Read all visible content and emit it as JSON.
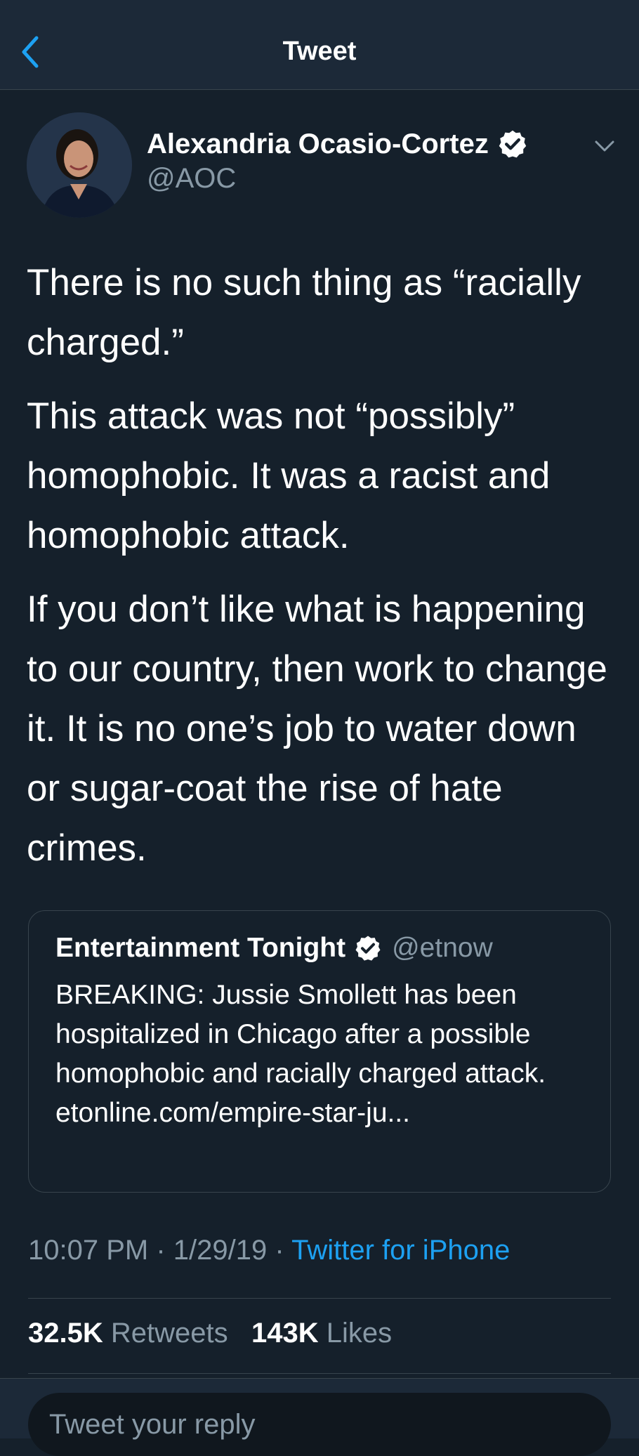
{
  "nav": {
    "title": "Tweet",
    "back_icon": "chevron-left-icon"
  },
  "tweet": {
    "author_name": "Alexandria Ocasio-Cortez",
    "author_handle": "@AOC",
    "verified": true,
    "paragraphs": [
      "There is no such thing as “racially charged.”",
      "This attack was not “possibly” homophobic. It was a racist and homophobic attack.",
      "If you don’t like what is happening to our country, then work to change it. It is no one’s job to water down or sugar-coat the rise of hate crimes."
    ],
    "quoted": {
      "author_name": "Entertainment Tonight",
      "author_handle": "@etnow",
      "verified": true,
      "text": "BREAKING: Jussie Smollett has been hospitalized in Chicago after a possible homophobic and racially charged attack. etonline.com/empire-star-ju..."
    },
    "time": "10:07 PM",
    "separator": "·",
    "date": "1/29/19",
    "source": "Twitter for iPhone",
    "retweets_count": "32.5K",
    "retweets_label": "Retweets",
    "likes_count": "143K",
    "likes_label": "Likes"
  },
  "reply": {
    "placeholder": "Tweet your reply"
  },
  "colors": {
    "background": "#15202b",
    "nav_background": "#1c2938",
    "accent": "#1da1f2",
    "secondary_text": "#8899a6",
    "border": "#38444d"
  }
}
